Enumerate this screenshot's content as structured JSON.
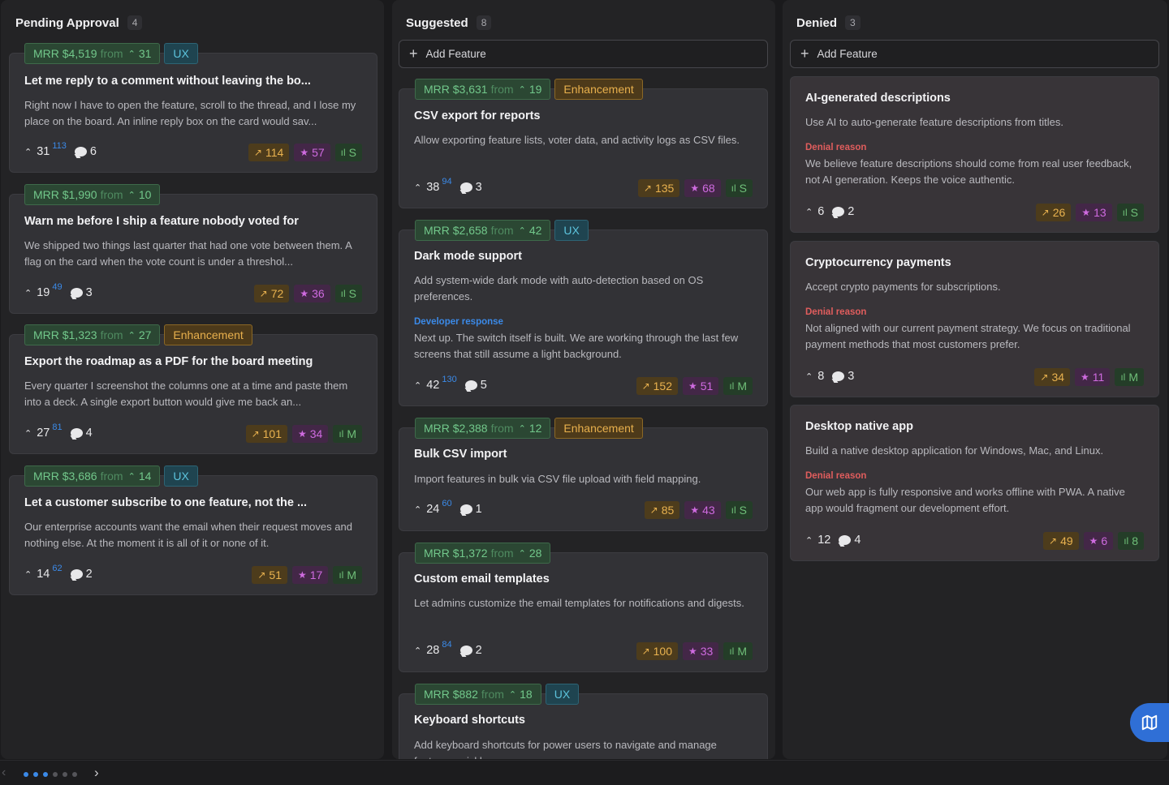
{
  "columns": [
    {
      "title": "Pending Approval",
      "count": "4",
      "cards": [
        {
          "mrr": "MRR $4,519",
          "from": "from",
          "mrr_votes": "31",
          "tag": "UX",
          "title": "Let me reply to a comment without leaving the bo...",
          "desc": "Right now I have to open the feature, scroll to the thread, and I lose my place on the board. An inline reply box on the card would sav...",
          "votes": "31",
          "score": "113",
          "comments": "6",
          "trend": "114",
          "stars": "57",
          "size": "S"
        },
        {
          "mrr": "MRR $1,990",
          "from": "from",
          "mrr_votes": "10",
          "title": "Warn me before I ship a feature nobody voted for",
          "desc": "We shipped two things last quarter that had one vote between them. A flag on the card when the vote count is under a threshol...",
          "votes": "19",
          "score": "49",
          "comments": "3",
          "trend": "72",
          "stars": "36",
          "size": "S"
        },
        {
          "mrr": "MRR $1,323",
          "from": "from",
          "mrr_votes": "27",
          "tag": "Enhancement",
          "title": "Export the roadmap as a PDF for the board meeting",
          "desc": "Every quarter I screenshot the columns one at a time and paste them into a deck. A single export button would give me back an...",
          "votes": "27",
          "score": "81",
          "comments": "4",
          "trend": "101",
          "stars": "34",
          "size": "M"
        },
        {
          "mrr": "MRR $3,686",
          "from": "from",
          "mrr_votes": "14",
          "tag": "UX",
          "title": "Let a customer subscribe to one feature, not the ...",
          "desc": "Our enterprise accounts want the email when their request moves and nothing else. At the moment it is all of it or none of it.",
          "votes": "14",
          "score": "62",
          "comments": "2",
          "trend": "51",
          "stars": "17",
          "size": "M"
        }
      ]
    },
    {
      "title": "Suggested",
      "count": "8",
      "add_label": "Add Feature",
      "cards": [
        {
          "mrr": "MRR $3,631",
          "from": "from",
          "mrr_votes": "19",
          "tag": "Enhancement",
          "title": "CSV export for reports",
          "desc": "Allow exporting feature lists, voter data, and activity logs as CSV files.",
          "votes": "38",
          "score": "94",
          "comments": "3",
          "trend": "135",
          "stars": "68",
          "size": "S"
        },
        {
          "mrr": "MRR $2,658",
          "from": "from",
          "mrr_votes": "42",
          "tag": "UX",
          "title": "Dark mode support",
          "desc": "Add system-wide dark mode with auto-detection based on OS preferences.",
          "response_label": "Developer response",
          "response": "Next up. The switch itself is built. We are working through the last few screens that still assume a light background.",
          "votes": "42",
          "score": "130",
          "comments": "5",
          "trend": "152",
          "stars": "51",
          "size": "M"
        },
        {
          "mrr": "MRR $2,388",
          "from": "from",
          "mrr_votes": "12",
          "tag": "Enhancement",
          "title": "Bulk CSV import",
          "desc": "Import features in bulk via CSV file upload with field mapping.",
          "votes": "24",
          "score": "60",
          "comments": "1",
          "trend": "85",
          "stars": "43",
          "size": "S"
        },
        {
          "mrr": "MRR $1,372",
          "from": "from",
          "mrr_votes": "28",
          "title": "Custom email templates",
          "desc": "Let admins customize the email templates for notifications and digests.",
          "votes": "28",
          "score": "84",
          "comments": "2",
          "trend": "100",
          "stars": "33",
          "size": "M"
        },
        {
          "mrr": "MRR $882",
          "from": "from",
          "mrr_votes": "18",
          "tag": "UX",
          "title": "Keyboard shortcuts",
          "desc": "Add keyboard shortcuts for power users to navigate and manage features quickly."
        }
      ]
    },
    {
      "title": "Denied",
      "count": "3",
      "add_label": "Add Feature",
      "cards": [
        {
          "title": "AI-generated descriptions",
          "desc": "Use AI to auto-generate feature descriptions from titles.",
          "response_label": "Denial reason",
          "response": "We believe feature descriptions should come from real user feedback, not AI generation. Keeps the voice authentic.",
          "votes": "6",
          "comments": "2",
          "trend": "26",
          "stars": "13",
          "size": "S"
        },
        {
          "title": "Cryptocurrency payments",
          "desc": "Accept crypto payments for subscriptions.",
          "response_label": "Denial reason",
          "response": "Not aligned with our current payment strategy. We focus on traditional payment methods that most customers prefer.",
          "votes": "8",
          "comments": "3",
          "trend": "34",
          "stars": "11",
          "size": "M"
        },
        {
          "title": "Desktop native app",
          "desc": "Build a native desktop application for Windows, Mac, and Linux.",
          "response_label": "Denial reason",
          "response": "Our web app is fully responsive and works offline with PWA. A native app would fragment our development effort.",
          "votes": "12",
          "comments": "4",
          "trend": "49",
          "stars": "6",
          "size": "8"
        }
      ]
    }
  ],
  "icons": {
    "trend": "trending-up-icon",
    "star": "star-icon",
    "size": "bar-chart-icon",
    "comment": "comment-icon",
    "upvote": "chevron-up-icon",
    "map": "map-icon"
  },
  "colors": {
    "accent": "#3b8ae8",
    "mrr": "#72c88b",
    "ux": "#5cc3dc",
    "enhancement": "#e8b04d",
    "denial": "#e05d5d"
  }
}
